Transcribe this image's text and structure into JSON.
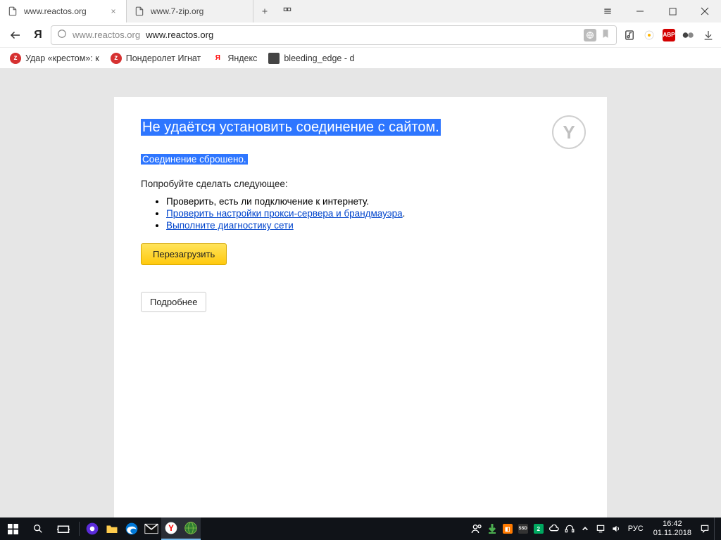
{
  "tabs": [
    {
      "title": "www.reactos.org",
      "active": true
    },
    {
      "title": "www.7-zip.org",
      "active": false
    }
  ],
  "addressbar": {
    "dimmed_url": "www.reactos.org",
    "display_url": "www.reactos.org"
  },
  "bookmarks": [
    {
      "label": "Удар «крестом»: к",
      "icon_bg": "#d63131",
      "icon_text": "z"
    },
    {
      "label": "Пондеролет Игнат",
      "icon_bg": "#d63131",
      "icon_text": "z"
    },
    {
      "label": "Яндекс",
      "icon_bg": "#ffffff",
      "icon_text": "Я",
      "icon_fg": "#ff0000"
    },
    {
      "label": "bleeding_edge - d",
      "icon_bg": "#444",
      "icon_text": ""
    }
  ],
  "error": {
    "title": "Не удаётся установить соединение с сайтом.",
    "subtitle": "Соединение сброшено.",
    "try_label": "Попробуйте сделать следующее:",
    "items": [
      {
        "text": "Проверить, есть ли подключение к интернету.",
        "link": false
      },
      {
        "text": "Проверить настройки прокси-сервера и брандмауэра",
        "link": true,
        "trailing": "."
      },
      {
        "text": "Выполните диагностику сети",
        "link": true
      }
    ],
    "reload_label": "Перезагрузить",
    "more_label": "Подробнее"
  },
  "abp_label": "ABP",
  "taskbar": {
    "lang": "РУС",
    "time": "16:42",
    "date": "01.11.2018",
    "tray_badge_ssd": "SSD",
    "tray_badge_2": "2"
  }
}
